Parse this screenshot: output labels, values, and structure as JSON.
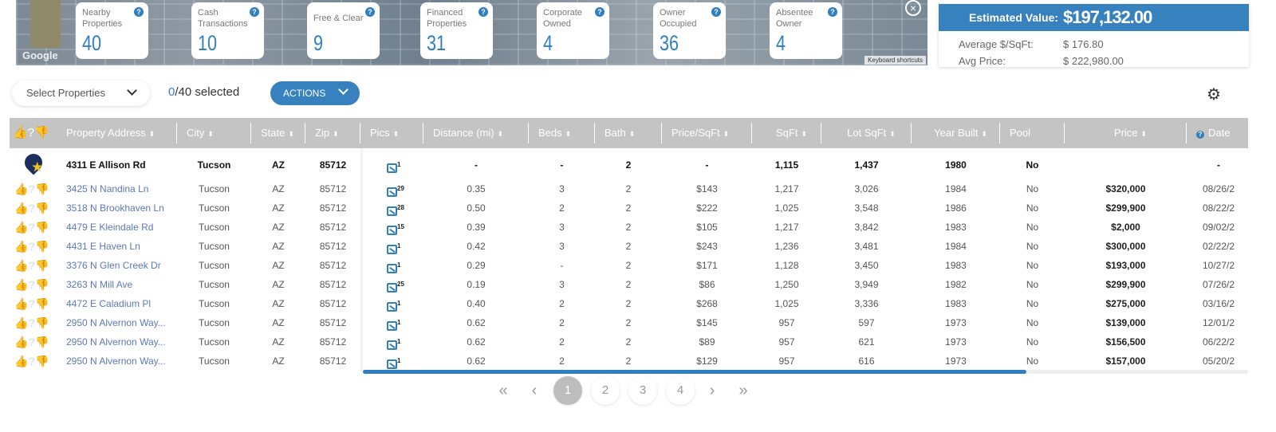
{
  "map": {
    "google_label": "Google",
    "keyboard_shortcuts": "Keyboard shortcuts",
    "close_icon": "close-circle-icon"
  },
  "stats": [
    {
      "label": "Nearby Properties",
      "value": "40"
    },
    {
      "label": "Cash Transactions",
      "value": "10"
    },
    {
      "label": "Free & Clear",
      "value": "9"
    },
    {
      "label": "Financed Properties",
      "value": "31"
    },
    {
      "label": "Corporate Owned",
      "value": "4"
    },
    {
      "label": "Owner Occupied",
      "value": "36"
    },
    {
      "label": "Absentee Owner",
      "value": "4"
    }
  ],
  "help_glyph": "?",
  "estimate": {
    "label": "Estimated Value:",
    "value": "$197,132.00",
    "avg_sqft_label": "Average $/SqFt:",
    "avg_sqft": "$ 176.80",
    "avg_price_label": "Avg Price:",
    "avg_price": "$ 222,980.00",
    "header_color": "#3781bf"
  },
  "toolbar": {
    "select_label": "Select Properties",
    "selected_count": "0",
    "selected_total": "/40 selected",
    "actions_label": "ACTIONS"
  },
  "columns": [
    "Property Address",
    "City",
    "State",
    "Zip",
    "Pics",
    "Distance (mi)",
    "Beds",
    "Bath",
    "Price/SqFt",
    "SqFt",
    "Lot SqFt",
    "Year Built",
    "Pool",
    "Price",
    "Date"
  ],
  "subject": {
    "address": "4311 E Allison Rd",
    "city": "Tucson",
    "state": "AZ",
    "zip": "85712",
    "pics": "1",
    "distance": "-",
    "beds": "-",
    "bath": "2",
    "price_sqft": "-",
    "sqft": "1,115",
    "lot": "1,437",
    "year": "1980",
    "pool": "No",
    "price": "",
    "date": "-"
  },
  "rows": [
    {
      "liked": true,
      "address": "3425 N Nandina Ln",
      "city": "Tucson",
      "state": "AZ",
      "zip": "85712",
      "pics": "29",
      "distance": "0.35",
      "beds": "3",
      "bath": "2",
      "price_sqft": "$143",
      "sqft": "1,217",
      "lot": "3,026",
      "year": "1984",
      "pool": "No",
      "price": "$320,000",
      "date": "08/26/2"
    },
    {
      "liked": true,
      "address": "3518 N Brookhaven Ln",
      "city": "Tucson",
      "state": "AZ",
      "zip": "85712",
      "pics": "28",
      "distance": "0.50",
      "beds": "2",
      "bath": "2",
      "price_sqft": "$222",
      "sqft": "1,025",
      "lot": "3,548",
      "year": "1986",
      "pool": "No",
      "price": "$299,900",
      "date": "08/22/2"
    },
    {
      "liked": true,
      "address": "4479 E Kleindale Rd",
      "city": "Tucson",
      "state": "AZ",
      "zip": "85712",
      "pics": "15",
      "distance": "0.39",
      "beds": "3",
      "bath": "2",
      "price_sqft": "$105",
      "sqft": "1,217",
      "lot": "3,842",
      "year": "1983",
      "pool": "No",
      "price": "$2,000",
      "date": "09/02/2"
    },
    {
      "liked": true,
      "address": "4431 E Haven Ln",
      "city": "Tucson",
      "state": "AZ",
      "zip": "85712",
      "pics": "1",
      "distance": "0.42",
      "beds": "3",
      "bath": "2",
      "price_sqft": "$243",
      "sqft": "1,236",
      "lot": "3,481",
      "year": "1984",
      "pool": "No",
      "price": "$300,000",
      "date": "02/22/2"
    },
    {
      "liked": true,
      "address": "3376 N Glen Creek Dr",
      "city": "Tucson",
      "state": "AZ",
      "zip": "85712",
      "pics": "1",
      "distance": "0.29",
      "beds": "-",
      "bath": "2",
      "price_sqft": "$171",
      "sqft": "1,128",
      "lot": "3,450",
      "year": "1983",
      "pool": "No",
      "price": "$193,000",
      "date": "10/27/2"
    },
    {
      "liked": false,
      "address": "3263 N Mill Ave",
      "city": "Tucson",
      "state": "AZ",
      "zip": "85712",
      "pics": "25",
      "distance": "0.19",
      "beds": "3",
      "bath": "2",
      "price_sqft": "$86",
      "sqft": "1,250",
      "lot": "3,949",
      "year": "1982",
      "pool": "No",
      "price": "$299,900",
      "date": "07/26/2"
    },
    {
      "liked": false,
      "address": "4472 E Caladium Pl",
      "city": "Tucson",
      "state": "AZ",
      "zip": "85712",
      "pics": "1",
      "distance": "0.40",
      "beds": "2",
      "bath": "2",
      "price_sqft": "$268",
      "sqft": "1,025",
      "lot": "3,336",
      "year": "1983",
      "pool": "No",
      "price": "$275,000",
      "date": "03/16/2"
    },
    {
      "liked": false,
      "address": "2950 N Alvernon Way...",
      "city": "Tucson",
      "state": "AZ",
      "zip": "85712",
      "pics": "1",
      "distance": "0.62",
      "beds": "2",
      "bath": "2",
      "price_sqft": "$145",
      "sqft": "957",
      "lot": "597",
      "year": "1973",
      "pool": "No",
      "price": "$139,000",
      "date": "12/01/2"
    },
    {
      "liked": false,
      "address": "2950 N Alvernon Way...",
      "city": "Tucson",
      "state": "AZ",
      "zip": "85712",
      "pics": "1",
      "distance": "0.62",
      "beds": "2",
      "bath": "2",
      "price_sqft": "$89",
      "sqft": "957",
      "lot": "621",
      "year": "1973",
      "pool": "No",
      "price": "$156,500",
      "date": "06/22/2"
    },
    {
      "liked": false,
      "address": "2950 N Alvernon Way...",
      "city": "Tucson",
      "state": "AZ",
      "zip": "85712",
      "pics": "1",
      "distance": "0.62",
      "beds": "2",
      "bath": "2",
      "price_sqft": "$129",
      "sqft": "957",
      "lot": "616",
      "year": "1973",
      "pool": "No",
      "price": "$157,000",
      "date": "05/20/2"
    }
  ],
  "pagination": {
    "first": "«",
    "prev": "‹",
    "pages": [
      "1",
      "2",
      "3",
      "4"
    ],
    "current": "1",
    "next": "›",
    "last": "»"
  },
  "colors": {
    "accent": "#2f7fc1",
    "header_bg": "#c4c4c4",
    "liked": "#2f7fc1",
    "unrated": "#dde3ea"
  }
}
